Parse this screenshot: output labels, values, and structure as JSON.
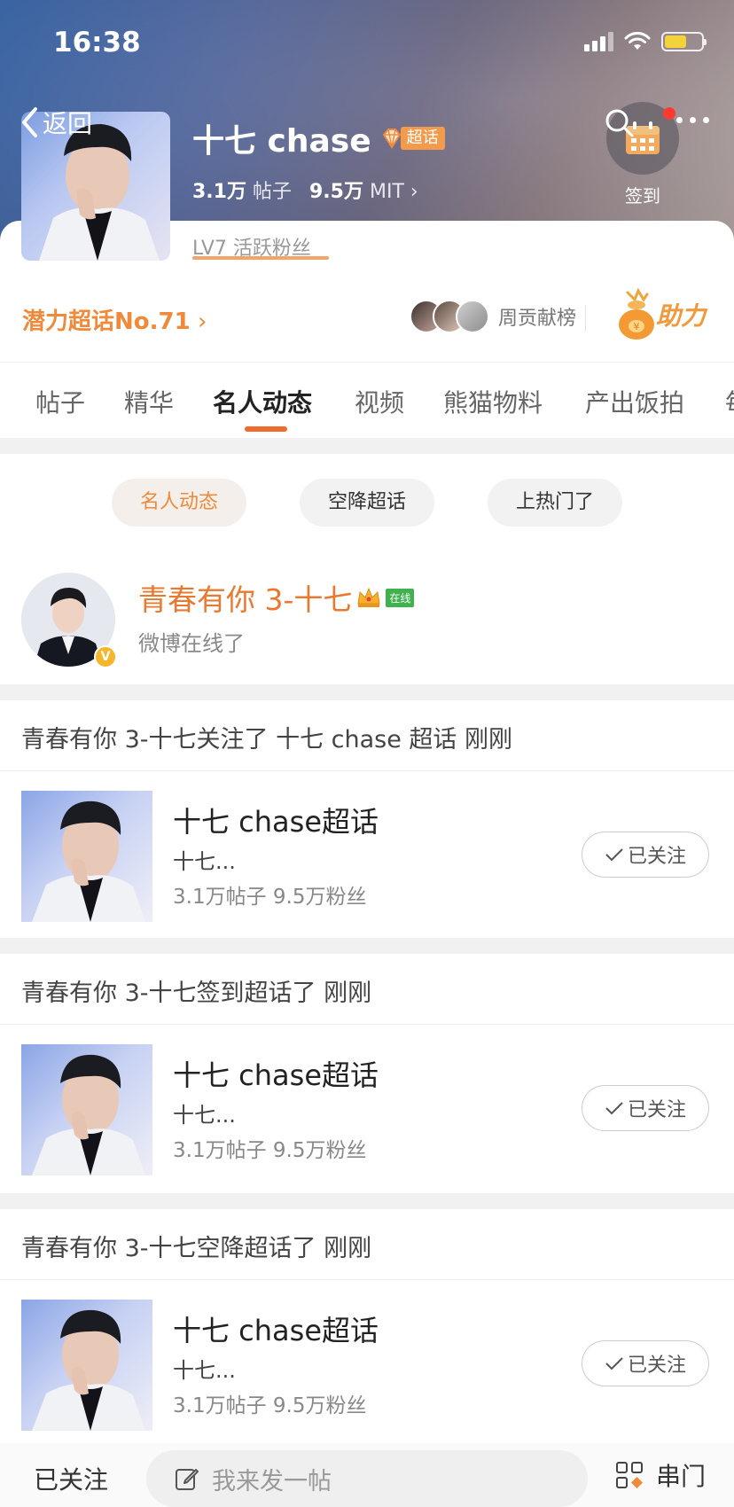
{
  "status_bar": {
    "time": "16:38",
    "battery_level": 0.6
  },
  "header": {
    "back_label": "返回",
    "title": "十七 chase",
    "super_badge": "超话",
    "posts_count": "3.1万",
    "posts_label": "帖子",
    "fans_count": "9.5万",
    "fans_label": "MIT",
    "checkin_label": "签到",
    "level_text": "LV7  活跃粉丝"
  },
  "potential": {
    "rank_text": "潜力超话No.71",
    "contrib_label": "周贡献榜",
    "help_label": "助力"
  },
  "tabs": [
    "帖子",
    "精华",
    "名人动态",
    "视频",
    "熊猫物料",
    "产出饭拍",
    "每"
  ],
  "active_tab": 2,
  "filters": [
    "名人动态",
    "空降超话",
    "上热门了"
  ],
  "active_filter": 0,
  "celebrity": {
    "name": "青春有你 3-十七",
    "online_badge": "在线",
    "status": "微博在线了"
  },
  "activities": [
    {
      "header": "青春有你 3-十七关注了 十七 chase 超话 刚刚",
      "card_title": "十七 chase超话",
      "card_sub": "十七...",
      "card_stats": "3.1万帖子   9.5万粉丝",
      "button": "已关注"
    },
    {
      "header": "青春有你 3-十七签到超话了 刚刚",
      "card_title": "十七 chase超话",
      "card_sub": "十七...",
      "card_stats": "3.1万帖子   9.5万粉丝",
      "button": "已关注"
    },
    {
      "header": "青春有你 3-十七空降超话了 刚刚",
      "card_title": "十七 chase超话",
      "card_sub": "十七...",
      "card_stats": "3.1万帖子   9.5万粉丝",
      "button": "已关注"
    }
  ],
  "bottom_bar": {
    "followed_label": "已关注",
    "input_placeholder": "我来发一帖",
    "door_label": "串门"
  },
  "colors": {
    "accent": "#f08a3a",
    "tab_underline": "#f06a2e",
    "online": "#3fb24e"
  }
}
